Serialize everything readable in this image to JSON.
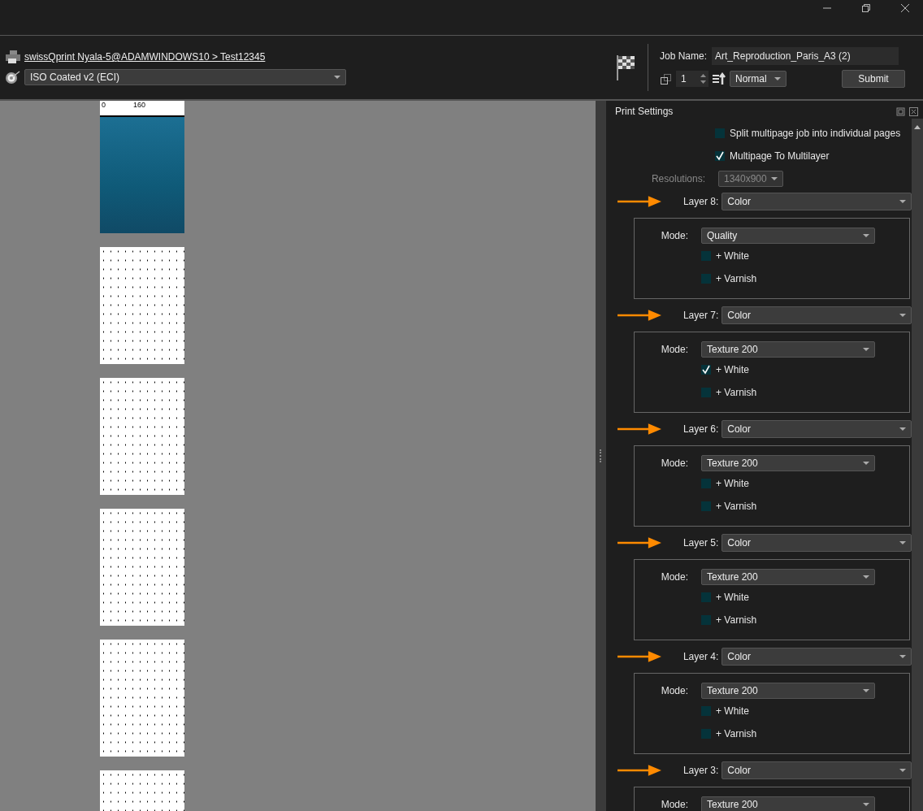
{
  "header": {
    "printer_path": "swissQprint Nyala-5@ADAMWINDOWS10 > Test12345",
    "color_profile": "ISO Coated v2 (ECI)",
    "job_name_label": "Job Name:",
    "job_name": "Art_Reproduction_Paris_A3 (2)",
    "copies": "1",
    "priority": "Normal",
    "submit": "Submit"
  },
  "preview": {
    "ruler_labels": [
      "0",
      "160"
    ]
  },
  "print_settings": {
    "title": "Print Settings",
    "options": [
      {
        "label": "Split multipage job into individual pages",
        "checked": false
      },
      {
        "label": "Multipage To Multilayer",
        "checked": true
      }
    ],
    "resolution_label": "Resolutions:",
    "resolution": "1340x900",
    "resolution_disabled": true,
    "layers": [
      {
        "label": "Layer 8:",
        "value": "Color",
        "mode_label": "Mode:",
        "mode": "Quality",
        "extras": [
          {
            "label": "+ White",
            "checked": false
          },
          {
            "label": "+ Varnish",
            "checked": false
          }
        ]
      },
      {
        "label": "Layer 7:",
        "value": "Color",
        "mode_label": "Mode:",
        "mode": "Texture 200",
        "extras": [
          {
            "label": "+ White",
            "checked": true
          },
          {
            "label": "+ Varnish",
            "checked": false
          }
        ]
      },
      {
        "label": "Layer 6:",
        "value": "Color",
        "mode_label": "Mode:",
        "mode": "Texture 200",
        "extras": [
          {
            "label": "+ White",
            "checked": false
          },
          {
            "label": "+ Varnish",
            "checked": false
          }
        ]
      },
      {
        "label": "Layer 5:",
        "value": "Color",
        "mode_label": "Mode:",
        "mode": "Texture 200",
        "extras": [
          {
            "label": "+ White",
            "checked": false
          },
          {
            "label": "+ Varnish",
            "checked": false
          }
        ]
      },
      {
        "label": "Layer 4:",
        "value": "Color",
        "mode_label": "Mode:",
        "mode": "Texture 200",
        "extras": [
          {
            "label": "+ White",
            "checked": false
          },
          {
            "label": "+ Varnish",
            "checked": false
          }
        ]
      },
      {
        "label": "Layer 3:",
        "value": "Color",
        "mode_label": "Mode:",
        "mode": "Texture 200"
      }
    ]
  }
}
